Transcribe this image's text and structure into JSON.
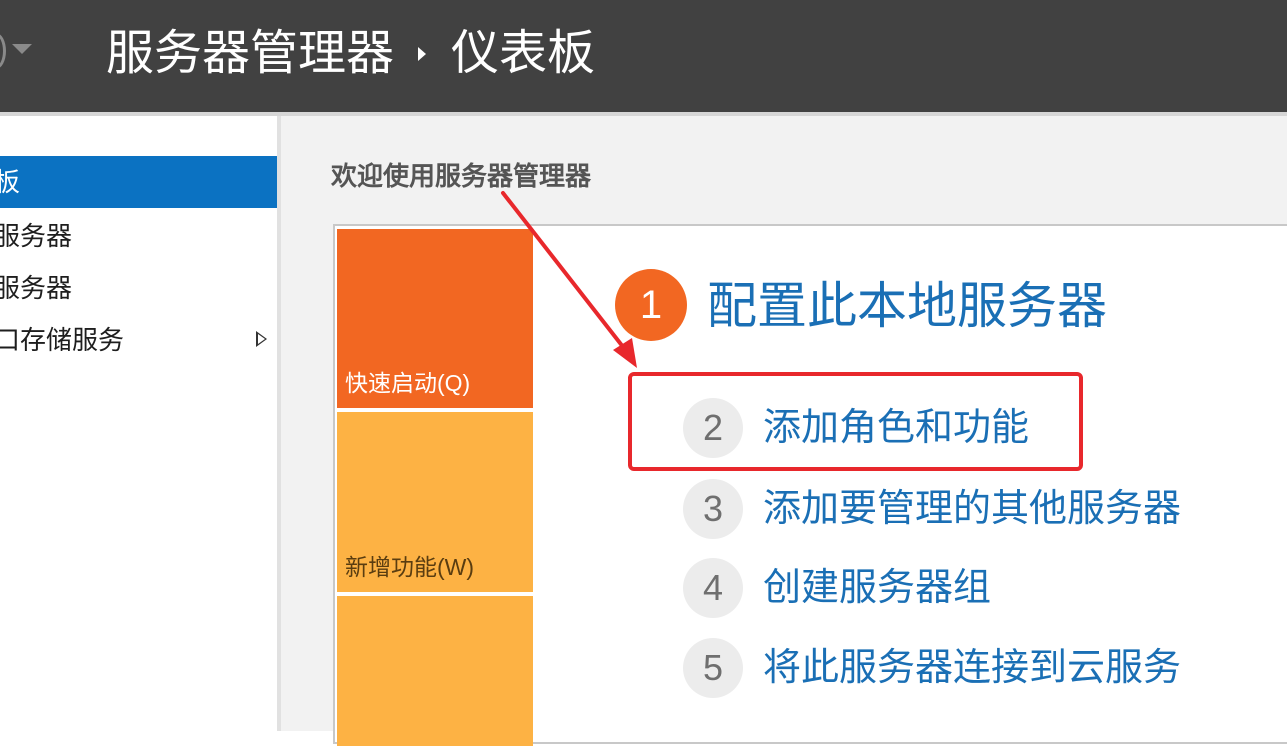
{
  "titlebar": {
    "breadcrumb_root": "服务器管理器",
    "breadcrumb_current": "仪表板"
  },
  "sidebar": {
    "items": [
      {
        "label": "板",
        "selected": true
      },
      {
        "label": "服务器"
      },
      {
        "label": "服务器"
      },
      {
        "label": "口存储服务",
        "expandable": true
      }
    ]
  },
  "main": {
    "welcome_title": "欢迎使用服务器管理器",
    "tiles": [
      {
        "label": "快速启动(Q)",
        "color": "#f26722"
      },
      {
        "label": "新增功能(W)",
        "color": "#fdb244"
      },
      {
        "label": "",
        "color": "#fdb244"
      }
    ],
    "active_step": {
      "number": "1",
      "text": "配置此本地服务器"
    },
    "steps": [
      {
        "number": "2",
        "text": "添加角色和功能"
      },
      {
        "number": "3",
        "text": "添加要管理的其他服务器"
      },
      {
        "number": "4",
        "text": "创建服务器组"
      },
      {
        "number": "5",
        "text": "将此服务器连接到云服务"
      }
    ]
  },
  "colors": {
    "titlebar_bg": "#414141",
    "selected_nav": "#0b72c2",
    "accent_orange": "#f26722",
    "accent_yellow": "#fdb244",
    "link_blue": "#1a6fb5",
    "annotation_red": "#e8282c"
  }
}
